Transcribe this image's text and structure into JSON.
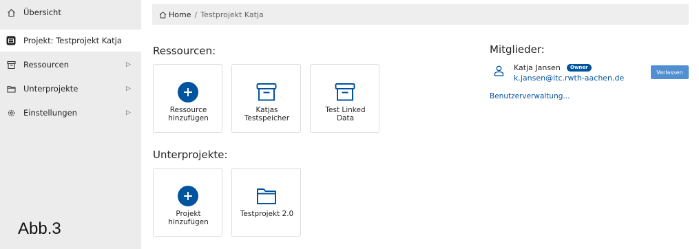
{
  "sidebar": {
    "items": [
      {
        "label": "Übersicht",
        "icon": "home-icon",
        "chevron": ""
      },
      {
        "label": "Projekt: Testprojekt Katja",
        "icon": "project-icon",
        "chevron": ""
      },
      {
        "label": "Ressourcen",
        "icon": "archive-icon",
        "chevron": "▷"
      },
      {
        "label": "Unterprojekte",
        "icon": "folder-icon",
        "chevron": "▷"
      },
      {
        "label": "Einstellungen",
        "icon": "gear-icon",
        "chevron": "▷"
      }
    ]
  },
  "figure_label": "Abb.3",
  "breadcrumb": {
    "home": "Home",
    "separator": "/",
    "current": "Testprojekt Katja"
  },
  "resources": {
    "title": "Ressourcen:",
    "tiles": [
      {
        "line1": "Ressource",
        "line2": "hinzufügen",
        "icon": "plus-circle-icon"
      },
      {
        "line1": "Katjas",
        "line2": "Testspeicher",
        "icon": "archive-icon"
      },
      {
        "line1": "Test Linked",
        "line2": "Data",
        "icon": "archive-icon"
      }
    ]
  },
  "subprojects": {
    "title": "Unterprojekte:",
    "tiles": [
      {
        "line1": "Projekt",
        "line2": "hinzufügen",
        "icon": "plus-circle-icon"
      },
      {
        "line1": "Testprojekt 2.0",
        "line2": "",
        "icon": "folder-icon"
      }
    ]
  },
  "members": {
    "title": "Mitglieder:",
    "list": [
      {
        "name": "Katja Jansen",
        "badge": "Owner",
        "email": "k.jansen@itc.rwth-aachen.de",
        "action": "Verlassen"
      }
    ],
    "manage_link": "Benutzerverwaltung..."
  },
  "colors": {
    "accent": "#00549f",
    "button": "#4f8fd2",
    "sidebar_bg": "#ececec"
  }
}
